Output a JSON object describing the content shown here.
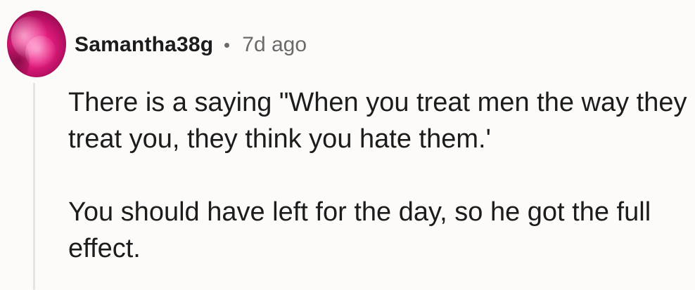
{
  "comment": {
    "author": {
      "username": "Samantha38g",
      "avatar_icon": "avatar-image"
    },
    "timestamp": "7d ago",
    "separator": "•",
    "body": {
      "paragraphs": [
        "There is a saying \"When you treat men the way they treat you, they think you hate them.'",
        "You should have left for the day, so he got the full effect."
      ]
    }
  },
  "colors": {
    "background": "#fcfbfa",
    "text": "#1c1c1c",
    "muted": "#6a6a6a",
    "thread_line": "#e7e3e0",
    "avatar_primary": "#e51d7f"
  }
}
